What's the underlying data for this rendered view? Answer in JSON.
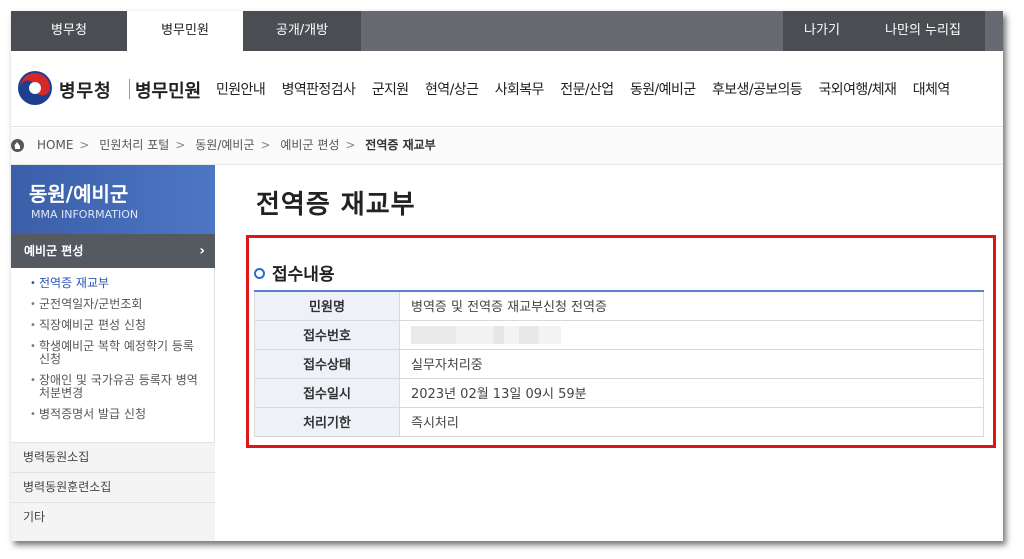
{
  "topbar": {
    "tabs": [
      "병무청",
      "병무민원",
      "공개/개방"
    ],
    "right": [
      "나가기",
      "나만의 누리집"
    ]
  },
  "header": {
    "logo_main": "병무청",
    "logo_sub": "병무민원",
    "gnb": [
      "민원안내",
      "병역판정검사",
      "군지원",
      "현역/상근",
      "사회복무",
      "전문/산업",
      "동원/예비군",
      "후보생/공보의등",
      "국외여행/체재",
      "대체역"
    ]
  },
  "breadcrumb": {
    "items": [
      "HOME",
      "민원처리 포털",
      "동원/예비군",
      "예비군 편성",
      "전역증 재교부"
    ],
    "separator": ">"
  },
  "sidebar": {
    "title": "동원/예비군",
    "subtitle": "MMA INFORMATION",
    "category": "예비군 편성",
    "category_arrow": "›",
    "items": [
      "전역증 재교부",
      "군전역일자/군번조회",
      "직장예비군 편성 신청",
      "학생예비군 복학 예정학기 등록 신청",
      "장애인 및 국가유공 등록자 병역처분변경",
      "병적증명서 발급 신청"
    ],
    "bottom": [
      "병력동원소집",
      "병력동원훈련소집",
      "기타"
    ]
  },
  "main": {
    "page_title": "전역증 재교부",
    "section_title": "접수내용",
    "rows": [
      {
        "label": "민원명",
        "value": "병역증 및 전역증 재교부신청  전역증"
      },
      {
        "label": "접수번호",
        "value": ""
      },
      {
        "label": "접수상태",
        "value": "실무자처리중"
      },
      {
        "label": "접수일시",
        "value": "2023년 02월 13일 09시 59분"
      },
      {
        "label": "처리기한",
        "value": "즉시처리"
      }
    ]
  },
  "colors": {
    "highlight": "#e01515",
    "sidebar_header": "#3b5ea8",
    "active_link": "#2a56b8",
    "topbar_dark": "#4a4d52"
  }
}
